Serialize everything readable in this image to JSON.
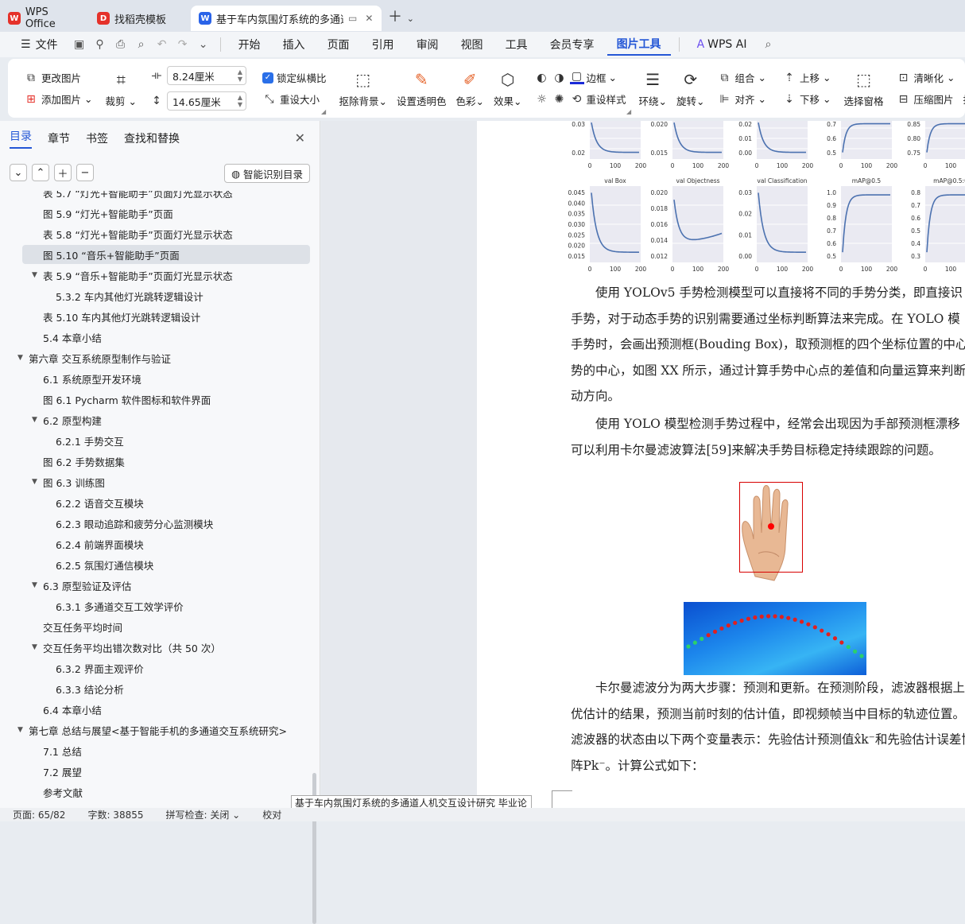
{
  "tabs": [
    {
      "label": "WPS Office",
      "logo": "W",
      "color": "#e5312a"
    },
    {
      "label": "找稻壳模板",
      "logo": "D",
      "color": "#e5312a"
    },
    {
      "label": "基于车内氛围灯系统的多通道",
      "logo": "W",
      "color": "#2a63e8"
    }
  ],
  "menubar": {
    "file": "文件",
    "items": [
      "开始",
      "插入",
      "页面",
      "引用",
      "审阅",
      "视图",
      "工具",
      "会员专享",
      "图片工具"
    ],
    "wps_ai": "WPS AI"
  },
  "ribbon": {
    "change_pic": "更改图片",
    "add_pic": "添加图片",
    "crop": "裁剪",
    "width": "8.24厘米",
    "height": "14.65厘米",
    "lock_ratio": "锁定纵横比",
    "resize": "重设大小",
    "remove_bg": "抠除背景",
    "transparent": "设置透明色",
    "color": "色彩",
    "effect": "效果",
    "border": "边框",
    "reset_style": "重设样式",
    "wrap": "环绕",
    "rotate": "旋转",
    "group": "组合",
    "align": "对齐",
    "up": "上移",
    "down": "下移",
    "select_pane": "选择窗格",
    "sharpen": "清晰化",
    "compress": "压缩图片",
    "batch": "批"
  },
  "sidebar": {
    "tabs": [
      "目录",
      "章节",
      "书签",
      "查找和替换"
    ],
    "smart_toc": "智能识别目录",
    "items": [
      {
        "label": "表 5.7 “灯光+智能助手”页面灯光显示状态",
        "level": 2,
        "tri": ""
      },
      {
        "label": "图 5.9 “灯光+智能助手”页面",
        "level": 2,
        "tri": ""
      },
      {
        "label": "表 5.8 “灯光+智能助手”页面灯光显示状态",
        "level": 2,
        "tri": ""
      },
      {
        "label": "图 5.10 “音乐+智能助手”页面",
        "level": 2,
        "tri": "",
        "selected": true
      },
      {
        "label": "表 5.9 “音乐+智能助手”页面灯光显示状态",
        "level": 2,
        "tri": "▼"
      },
      {
        "label": "5.3.2 车内其他灯光跳转逻辑设计",
        "level": 3,
        "tri": ""
      },
      {
        "label": "表 5.10 车内其他灯光跳转逻辑设计",
        "level": 2,
        "tri": ""
      },
      {
        "label": "5.4 本章小结",
        "level": 2,
        "tri": ""
      },
      {
        "label": "第六章 交互系统原型制作与验证",
        "level": 1,
        "tri": "▼"
      },
      {
        "label": "6.1 系统原型开发环境",
        "level": 2,
        "tri": ""
      },
      {
        "label": "图 6.1 Pycharm 软件图标和软件界面",
        "level": 2,
        "tri": ""
      },
      {
        "label": "6.2 原型构建",
        "level": 2,
        "tri": "▼"
      },
      {
        "label": "6.2.1 手势交互",
        "level": 3,
        "tri": ""
      },
      {
        "label": "图 6.2 手势数据集",
        "level": 2,
        "tri": ""
      },
      {
        "label": "图 6.3 训练图",
        "level": 2,
        "tri": "▼"
      },
      {
        "label": "6.2.2 语音交互模块",
        "level": 3,
        "tri": ""
      },
      {
        "label": "6.2.3 眼动追踪和疲劳分心监测模块",
        "level": 3,
        "tri": ""
      },
      {
        "label": "6.2.4 前端界面模块",
        "level": 3,
        "tri": ""
      },
      {
        "label": "6.2.5 氛围灯通信模块",
        "level": 3,
        "tri": ""
      },
      {
        "label": "6.3 原型验证及评估",
        "level": 2,
        "tri": "▼"
      },
      {
        "label": "6.3.1 多通道交互工效学评价",
        "level": 3,
        "tri": ""
      },
      {
        "label": "交互任务平均时间",
        "level": 2,
        "tri": ""
      },
      {
        "label": "交互任务平均出错次数对比（共 50 次）",
        "level": 2,
        "tri": "▼"
      },
      {
        "label": "6.3.2 界面主观评价",
        "level": 3,
        "tri": ""
      },
      {
        "label": "6.3.3 结论分析",
        "level": 3,
        "tri": ""
      },
      {
        "label": "6.4 本章小结",
        "level": 2,
        "tri": ""
      },
      {
        "label": "第七章 总结与展望<基于智能手机的多通道交互系统研究>",
        "level": 1,
        "tri": "▼",
        "tight": true
      },
      {
        "label": "7.1 总结",
        "level": 2,
        "tri": ""
      },
      {
        "label": "7.2 展望",
        "level": 2,
        "tri": ""
      },
      {
        "label": "参考文献",
        "level": 2,
        "tri": ""
      }
    ]
  },
  "charts_row1": [
    {
      "yticks": [
        "0.03",
        "0.02"
      ],
      "xticks": [
        "0",
        "100",
        "200"
      ]
    },
    {
      "yticks": [
        "0.020",
        "0.015"
      ],
      "xticks": [
        "0",
        "100",
        "200"
      ]
    },
    {
      "yticks": [
        "0.02",
        "0.01",
        "0.00"
      ],
      "xticks": [
        "0",
        "100",
        "200"
      ]
    },
    {
      "yticks": [
        "0.7",
        "0.6",
        "0.5"
      ],
      "xticks": [
        "0",
        "100",
        "200"
      ]
    },
    {
      "yticks": [
        "0.85",
        "0.80",
        "0.75"
      ],
      "xticks": [
        "0",
        "100"
      ]
    }
  ],
  "charts_row2": [
    {
      "title": "val Box",
      "yticks": [
        "0.045",
        "0.040",
        "0.035",
        "0.030",
        "0.025",
        "0.020",
        "0.015"
      ],
      "xticks": [
        "0",
        "100",
        "200"
      ],
      "shape": "decay"
    },
    {
      "title": "val Objectness",
      "yticks": [
        "0.020",
        "0.018",
        "0.016",
        "0.014",
        "0.012"
      ],
      "xticks": [
        "0",
        "100",
        "200"
      ],
      "shape": "u"
    },
    {
      "title": "val Classification",
      "yticks": [
        "0.03",
        "0.02",
        "0.01",
        "0.00"
      ],
      "xticks": [
        "0",
        "100",
        "200"
      ],
      "shape": "decay"
    },
    {
      "title": "mAP@0.5",
      "yticks": [
        "1.0",
        "0.9",
        "0.8",
        "0.7",
        "0.6",
        "0.5"
      ],
      "xticks": [
        "0",
        "100",
        "200"
      ],
      "shape": "rise"
    },
    {
      "title": "mAP@0.5:0",
      "yticks": [
        "0.8",
        "0.7",
        "0.6",
        "0.5",
        "0.4",
        "0.3"
      ],
      "xticks": [
        "0",
        "100"
      ],
      "shape": "rise"
    }
  ],
  "paragraphs": {
    "p1": [
      "　　使用 YOLOv5 手势检测模型可以直接将不同的手势分类，即直接识",
      "手势，对于动态手势的识别需要通过坐标判断算法来完成。在 YOLO 模",
      "手势时，会画出预测框(Bouding Box)，取预测框的四个坐标位置的中心点",
      "势的中心，如图 XX 所示，通过计算手势中心点的差值和向量运算来判断",
      "动方向。"
    ],
    "p2": [
      "　　使用 YOLO 模型检测手势过程中，经常会出现因为手部预测框漂移",
      "可以利用卡尔曼滤波算法[59]来解决手势目标稳定持续跟踪的问题。"
    ],
    "p3": [
      "　　卡尔曼滤波分为两大步骤：预测和更新。在预测阶段，滤波器根据上",
      "优估计的结果，预测当前时刻的估计值，即视频帧当中目标的轨迹位置。",
      "滤波器的状态由以下两个变量表示：先验估计预测值x̂k⁻和先验估计误差协",
      "阵Pk⁻。计算公式如下："
    ]
  },
  "tooltip": "基于车内氛围灯系统的多通道人机交互设计研究 毕业论文.docx - WPS Office",
  "status": {
    "page": "页面: 65/82",
    "words": "字数: 38855",
    "spell": "拼写检查: 关闭",
    "proof": "校对"
  }
}
